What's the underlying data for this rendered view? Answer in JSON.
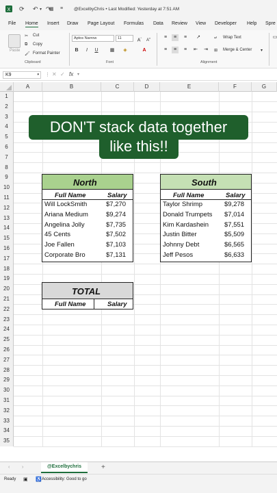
{
  "titlebar": {
    "title": "@ExcelbyChris • Last Modified: Yesterday at 7:51 AM"
  },
  "menu": {
    "items": [
      "File",
      "Home",
      "Insert",
      "Draw",
      "Page Layout",
      "Formulas",
      "Data",
      "Review",
      "View",
      "Developer",
      "Help",
      "Spre"
    ]
  },
  "ribbon": {
    "paste": "Paste",
    "cut": "Cut",
    "copy": "Copy",
    "format_painter": "Format Painter",
    "clipboard_group": "Clipboard",
    "font_name": "Aptos Narrow",
    "font_size": "11",
    "font_group": "Font",
    "wrap_text": "Wrap Text",
    "merge_center": "Merge & Center",
    "alignment_group": "Alignment",
    "bold": "B",
    "italic": "I",
    "underline": "U"
  },
  "formula_bar": {
    "cell_ref": "K9",
    "fx": "fx"
  },
  "columns": [
    "A",
    "B",
    "C",
    "D",
    "E",
    "F",
    "G"
  ],
  "rows": [
    "1",
    "2",
    "3",
    "4",
    "5",
    "6",
    "7",
    "8",
    "9",
    "10",
    "11",
    "12",
    "13",
    "14",
    "15",
    "16",
    "17",
    "18",
    "19",
    "20",
    "21",
    "22",
    "23",
    "24",
    "25",
    "26",
    "27",
    "28",
    "29",
    "30",
    "31",
    "32",
    "33",
    "34",
    "35"
  ],
  "banner": {
    "line1": "DON'T stack data together",
    "line2": "like this!!"
  },
  "north": {
    "title": "North",
    "col1": "Full Name",
    "col2": "Salary",
    "rows": [
      [
        "Will LockSmith",
        "$7,270"
      ],
      [
        "Ariana Medium",
        "$9,274"
      ],
      [
        "Angelina Jolly",
        "$7,735"
      ],
      [
        "45 Cents",
        "$7,502"
      ],
      [
        "Joe Fallen",
        "$7,103"
      ],
      [
        "Corporate Bro",
        "$7,131"
      ]
    ]
  },
  "south": {
    "title": "South",
    "col1": "Full Name",
    "col2": "Salary",
    "rows": [
      [
        "Taylor Shrimp",
        "$9,278"
      ],
      [
        "Donald Trumpets",
        "$7,014"
      ],
      [
        "Kim Kardashein",
        "$7,551"
      ],
      [
        "Justin Bitter",
        "$5,509"
      ],
      [
        "Johnny Debt",
        "$6,565"
      ],
      [
        "Jeff Pesos",
        "$6,633"
      ]
    ]
  },
  "total": {
    "title": "TOTAL",
    "col1": "Full Name",
    "col2": "Salary"
  },
  "sheet_tab": "@Excelbychris",
  "add_sheet": "+",
  "status": {
    "ready": "Ready",
    "accessibility": "Accessibility: Good to go"
  },
  "colors": {
    "north_header": "#a9d18e",
    "south_header": "#c5e0b4",
    "total_header": "#d9d9d9",
    "banner_bg": "#1f5f2c",
    "accent": "#1e6e3c"
  }
}
